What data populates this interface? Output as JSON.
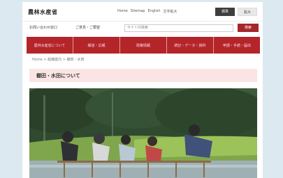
{
  "site": {
    "title": "農林水産省"
  },
  "top_links": [
    "Home",
    "Sitemap",
    "English",
    "文字拡大"
  ],
  "top_buttons": {
    "primary": "標準",
    "secondary": "拡大"
  },
  "subnav": {
    "items": [
      "お問い合わせ窓口",
      "ご意見・ご要望"
    ],
    "search_placeholder": "サイト内検索",
    "search_button": "検索"
  },
  "main_nav": [
    "農林水産省について",
    "報道・広報",
    "政策情報",
    "統計・データ・資料",
    "申請・手続・届出"
  ],
  "breadcrumb": "Home > 組織案内 > 棚田・水田",
  "heading": "棚田・水田について",
  "photo": {
    "alt_name": "rice-planting-photo"
  },
  "colors": {
    "brand_red": "#b4252a",
    "heading_bg": "#fbe4e4",
    "page_bg": "#dde9f1",
    "dark_button": "#3e3e3e"
  }
}
